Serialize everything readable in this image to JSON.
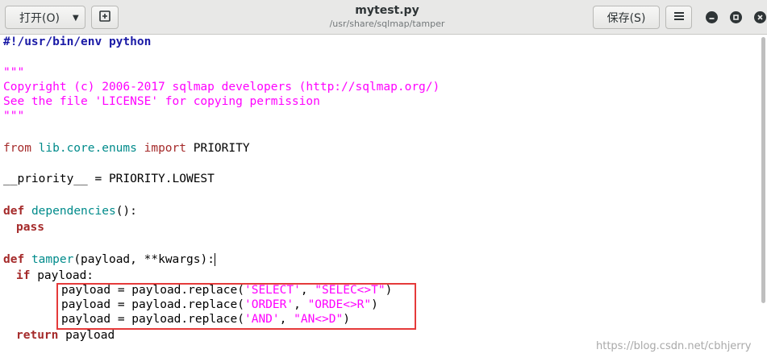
{
  "header": {
    "open_label": "打开(O)",
    "open_caret_icon": "chevron-down-icon",
    "new_document_icon": "new-document-icon",
    "title": "mytest.py",
    "path": "/usr/share/sqlmap/tamper",
    "save_label": "保存(S)",
    "menu_icon": "hamburger-menu-icon"
  },
  "window_controls": [
    "minimize-icon",
    "maximize-icon",
    "close-icon"
  ],
  "code": {
    "l1": "#!/usr/bin/env python",
    "l3": "\"\"\"",
    "l4": "Copyright (c) 2006-2017 sqlmap developers (http://sqlmap.org/)",
    "l5": "See the file 'LICENSE' for copying permission",
    "l6": "\"\"\"",
    "l8_from": "from",
    "l8_mod": "lib.core.enums",
    "l8_import": "import",
    "l8_rest": " PRIORITY",
    "l10": "__priority__ = PRIORITY.LOWEST",
    "l12_def": "def",
    "l12_name": "dependencies",
    "l12_rest": "():",
    "l13": "pass",
    "l15_def": "def",
    "l15_name": "tamper",
    "l15_rest": "(payload, **kwargs):",
    "l16_if": "if",
    "l16_rest": " payload:",
    "l17_pre": "payload = payload.replace(",
    "l17_a": "'SELECT'",
    "l17_sep": ", ",
    "l17_b": "\"SELEC<>T\"",
    "l17_end": ")",
    "l18_pre": "payload = payload.replace(",
    "l18_a": "'ORDER'",
    "l18_sep": ", ",
    "l18_b": "\"ORDE<>R\"",
    "l18_end": ")",
    "l19_pre": "payload = payload.replace(",
    "l19_a": "'AND'",
    "l19_sep": ", ",
    "l19_b": "\"AN<>D\"",
    "l19_end": ")",
    "l20_kw": "return",
    "l20_rest": " payload"
  },
  "watermark": "https://blog.csdn.net/cbhjerry",
  "colors": {
    "keyword": "#a52a2a",
    "string": "#ff00ff",
    "function": "#008b8b",
    "shebang": "#1a1aa6",
    "annotation_box": "#e53a3a"
  }
}
